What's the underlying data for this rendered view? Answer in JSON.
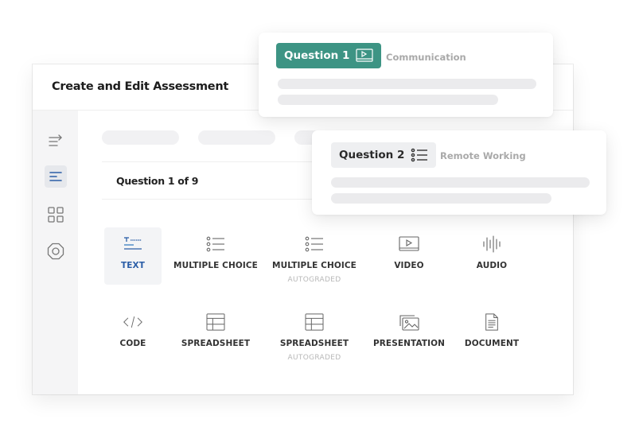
{
  "panel": {
    "title": "Create and Edit Assessment"
  },
  "sidebar": {
    "items": [
      {
        "name": "collapse",
        "icon": "collapse-arrow-icon",
        "active": false
      },
      {
        "name": "questions",
        "icon": "align-left-icon",
        "active": true
      },
      {
        "name": "grid",
        "icon": "grid-icon",
        "active": false
      },
      {
        "name": "settings",
        "icon": "settings-icon",
        "active": false
      }
    ]
  },
  "content": {
    "question_count": "Question 1 of 9",
    "question_types": [
      {
        "label": "TEXT",
        "sublabel": "",
        "icon": "text-icon",
        "selected": true
      },
      {
        "label": "MULTIPLE CHOICE",
        "sublabel": "",
        "icon": "list-icon",
        "selected": false
      },
      {
        "label": "MULTIPLE CHOICE",
        "sublabel": "AUTOGRADED",
        "icon": "list-icon",
        "selected": false
      },
      {
        "label": "VIDEO",
        "sublabel": "",
        "icon": "video-icon",
        "selected": false
      },
      {
        "label": "AUDIO",
        "sublabel": "",
        "icon": "audio-waveform-icon",
        "selected": false
      },
      {
        "label": "CODE",
        "sublabel": "",
        "icon": "code-icon",
        "selected": false
      },
      {
        "label": "SPREADSHEET",
        "sublabel": "",
        "icon": "spreadsheet-icon",
        "selected": false
      },
      {
        "label": "SPREADSHEET",
        "sublabel": "AUTOGRADED",
        "icon": "spreadsheet-icon",
        "selected": false
      },
      {
        "label": "PRESENTATION",
        "sublabel": "",
        "icon": "presentation-icon",
        "selected": false
      },
      {
        "label": "DOCUMENT",
        "sublabel": "",
        "icon": "document-icon",
        "selected": false
      }
    ]
  },
  "cards": [
    {
      "badge": "Question 1",
      "badge_icon": "video-icon",
      "topic": "Communication",
      "badge_color": "#3d9484"
    },
    {
      "badge": "Question 2",
      "badge_icon": "list-icon",
      "topic": "Remote Working",
      "badge_color": "#eeeff1"
    }
  ],
  "colors": {
    "accent_teal": "#3d9484",
    "accent_blue": "#2b5ea7",
    "text_dark": "#222222",
    "muted": "#a9a9a9"
  }
}
